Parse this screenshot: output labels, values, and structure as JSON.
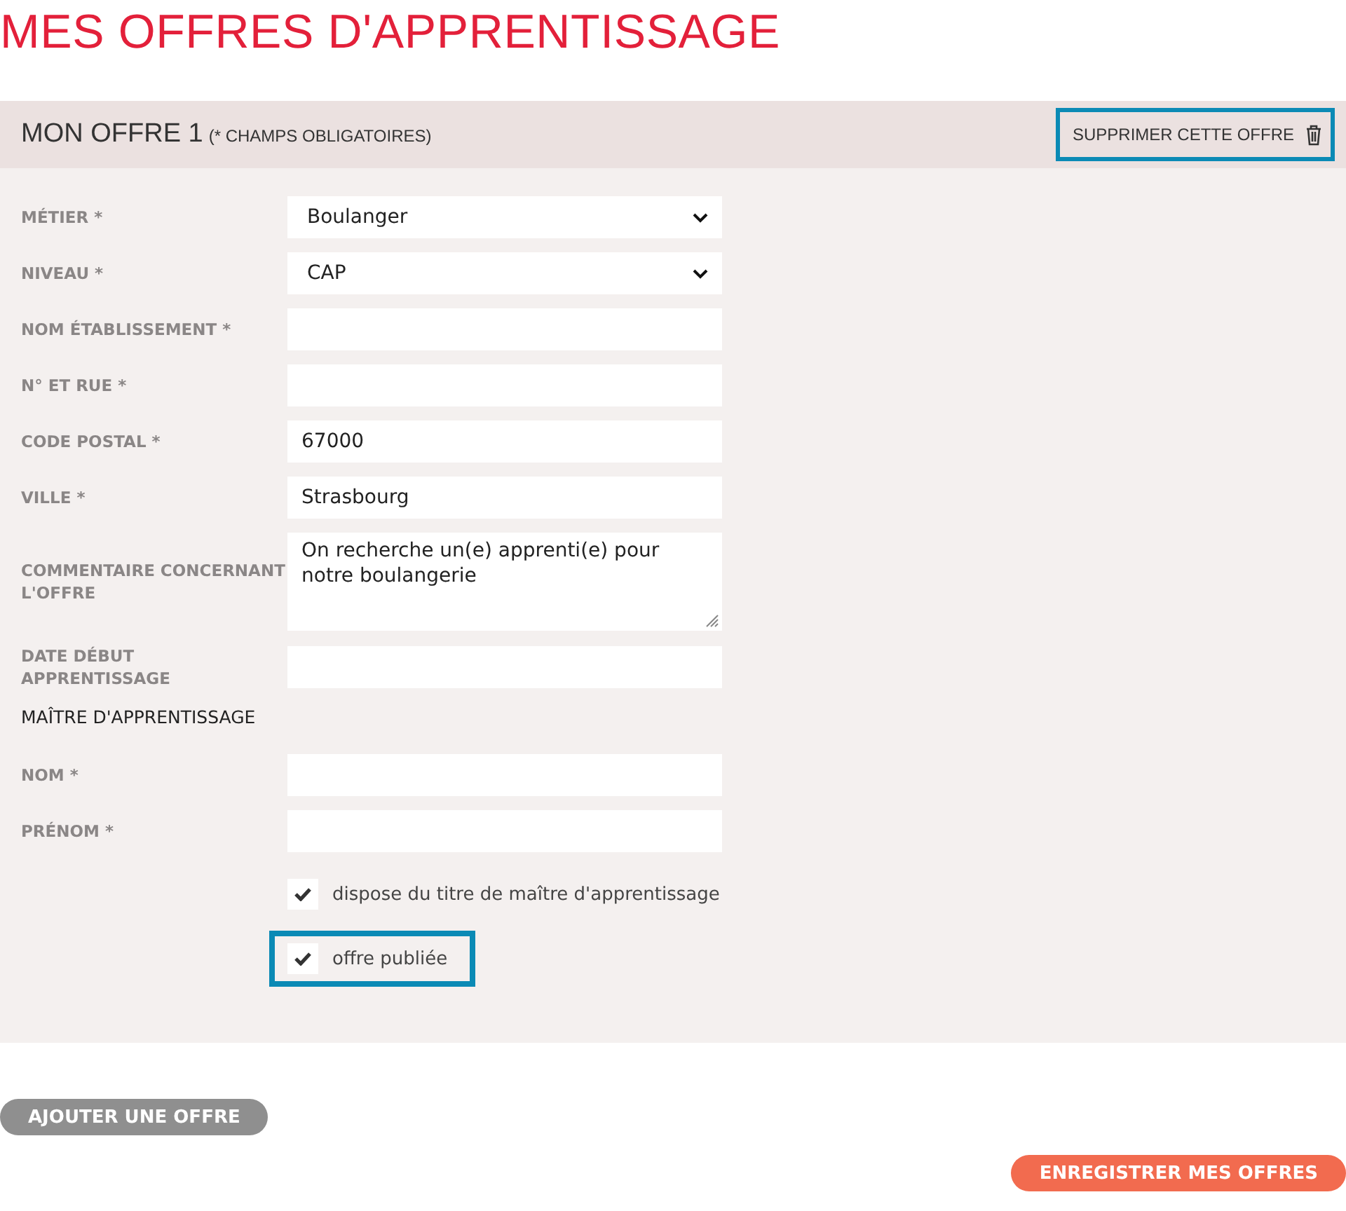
{
  "page_title": "MES OFFRES D'APPRENTISSAGE",
  "offer": {
    "title": "MON OFFRE 1",
    "note": "(* CHAMPS OBLIGATOIRES)",
    "delete_button": {
      "label": "SUPPRIMER CETTE OFFRE",
      "highlighted": true
    },
    "fields": [
      {
        "kind": "select",
        "label": "MÉTIER *",
        "value": "Boulanger"
      },
      {
        "kind": "select",
        "label": "NIVEAU *",
        "value": "CAP"
      },
      {
        "kind": "text",
        "label": "NOM ÉTABLISSEMENT *"
      },
      {
        "kind": "text",
        "label": "N° ET RUE *"
      },
      {
        "kind": "text",
        "label": "CODE POSTAL *",
        "value": "67000"
      },
      {
        "kind": "text",
        "label": "VILLE *",
        "value": "Strasbourg"
      },
      {
        "kind": "textarea",
        "label": "COMMENTAIRE CONCERNANT L'OFFRE",
        "value": "On recherche un(e) apprenti(e) pour notre boulangerie"
      },
      {
        "kind": "text",
        "label": "DATE DÉBUT APPRENTISSAGE"
      },
      {
        "kind": "section",
        "label": "MAÎTRE D'APPRENTISSAGE"
      },
      {
        "kind": "text",
        "label": "NOM *"
      },
      {
        "kind": "text",
        "label": "PRÉNOM *"
      }
    ],
    "checkboxes": [
      {
        "label": "dispose du titre de maître d'apprentissage",
        "checked": true,
        "highlighted": false
      },
      {
        "label": "offre publiée",
        "checked": true,
        "highlighted": true
      }
    ]
  },
  "add_button": "AJOUTER UNE OFFRE",
  "save_button": "ENREGISTRER MES OFFRES"
}
